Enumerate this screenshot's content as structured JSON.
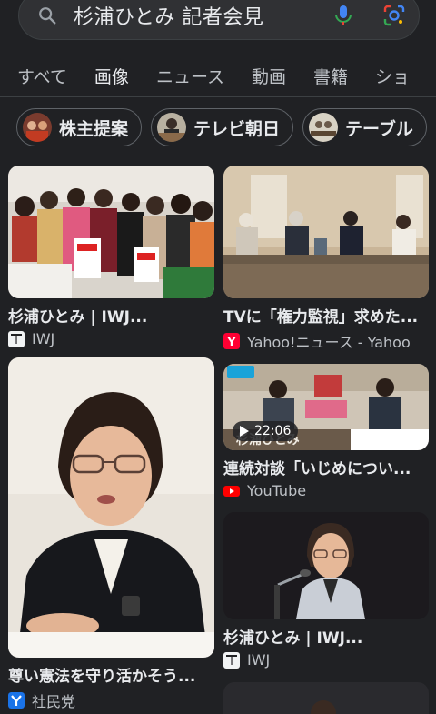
{
  "search": {
    "query": "杉浦ひとみ 記者会見"
  },
  "tabs": [
    "すべて",
    "画像",
    "ニュース",
    "動画",
    "書籍",
    "ショ"
  ],
  "chips": [
    "株主提案",
    "テレビ朝日",
    "テーブル"
  ],
  "results": [
    {
      "title": "杉浦ひとみ | IWJ...",
      "source": "IWJ",
      "source_icon": "iwj-icon"
    },
    {
      "title": "TVに「権力監視」求めた...",
      "source": "Yahoo!ニュース - Yahoo",
      "source_icon": "yahoo-icon"
    },
    {
      "title": "尊い憲法を守り活かそう...",
      "source": "社民党",
      "source_icon": "sdp-icon"
    },
    {
      "title": "連続対談「いじめについ...",
      "source": "YouTube",
      "source_icon": "youtube-icon",
      "duration": "22:06",
      "overlay_text": "杉浦ひとみ"
    },
    {
      "title": "杉浦ひとみ | IWJ...",
      "source": "IWJ",
      "source_icon": "iwj-icon"
    }
  ],
  "colors": {
    "background": "#202124",
    "accent": "#8ab4f8",
    "text": "#e8eaed",
    "muted": "#bdc1c6"
  }
}
